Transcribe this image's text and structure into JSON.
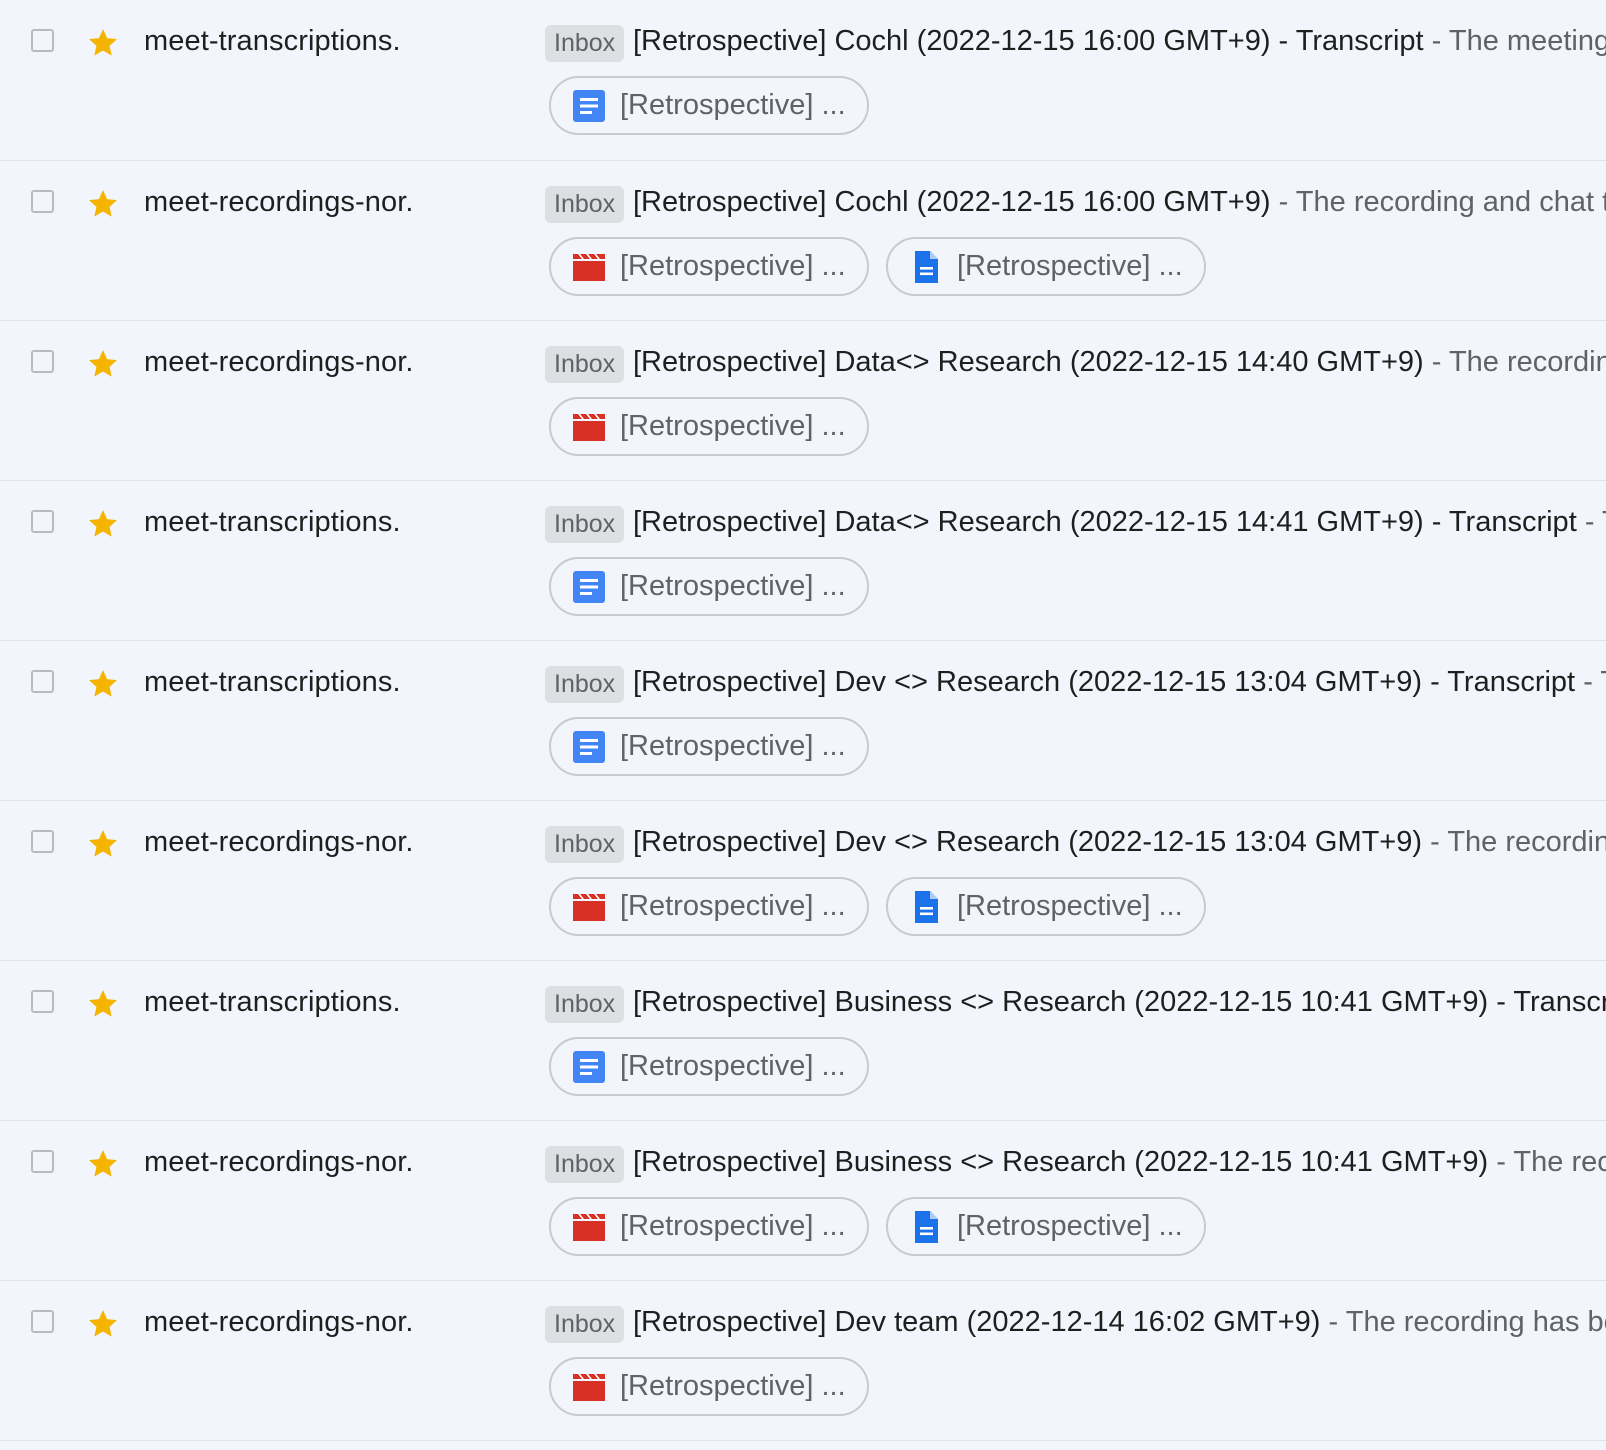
{
  "colors": {
    "star": "#f4b400",
    "doc_icon": "#4285f4",
    "file_icon": "#1a73e8",
    "video_icon": "#d93025"
  },
  "emails": [
    {
      "sender": "meet-transcriptions.",
      "label": "Inbox",
      "subject": "[Retrospective] Cochl (2022-12-15 16:00 GMT+9) - Transcript",
      "separator": "-",
      "snippet": "The meeting t",
      "attachments": [
        {
          "icon": "docs-icon",
          "label": "[Retrospective] ..."
        }
      ]
    },
    {
      "sender": "meet-recordings-nor.",
      "label": "Inbox",
      "subject": "[Retrospective] Cochl (2022-12-15 16:00 GMT+9)",
      "separator": "-",
      "snippet": "The recording and chat tra",
      "attachments": [
        {
          "icon": "video-icon",
          "label": "[Retrospective] ..."
        },
        {
          "icon": "file-icon",
          "label": "[Retrospective] ..."
        }
      ]
    },
    {
      "sender": "meet-recordings-nor.",
      "label": "Inbox",
      "subject": "[Retrospective] Data<> Research (2022-12-15 14:40 GMT+9)",
      "separator": "-",
      "snippet": "The recording h",
      "attachments": [
        {
          "icon": "video-icon",
          "label": "[Retrospective] ..."
        }
      ]
    },
    {
      "sender": "meet-transcriptions.",
      "label": "Inbox",
      "subject": "[Retrospective] Data<> Research (2022-12-15 14:41 GMT+9) - Transcript",
      "separator": "-",
      "snippet": "The",
      "attachments": [
        {
          "icon": "docs-icon",
          "label": "[Retrospective] ..."
        }
      ]
    },
    {
      "sender": "meet-transcriptions.",
      "label": "Inbox",
      "subject": "[Retrospective] Dev <> Research (2022-12-15 13:04 GMT+9) - Transcript",
      "separator": "-",
      "snippet": "The",
      "attachments": [
        {
          "icon": "docs-icon",
          "label": "[Retrospective] ..."
        }
      ]
    },
    {
      "sender": "meet-recordings-nor.",
      "label": "Inbox",
      "subject": "[Retrospective] Dev <> Research (2022-12-15 13:04 GMT+9)",
      "separator": "-",
      "snippet": "The recording a",
      "attachments": [
        {
          "icon": "video-icon",
          "label": "[Retrospective] ..."
        },
        {
          "icon": "file-icon",
          "label": "[Retrospective] ..."
        }
      ]
    },
    {
      "sender": "meet-transcriptions.",
      "label": "Inbox",
      "subject": "[Retrospective] Business <> Research (2022-12-15 10:41 GMT+9) - Transcript",
      "separator": "",
      "snippet": "",
      "attachments": [
        {
          "icon": "docs-icon",
          "label": "[Retrospective] ..."
        }
      ]
    },
    {
      "sender": "meet-recordings-nor.",
      "label": "Inbox",
      "subject": "[Retrospective] Business <> Research (2022-12-15 10:41 GMT+9)",
      "separator": "-",
      "snippet": "The record",
      "attachments": [
        {
          "icon": "video-icon",
          "label": "[Retrospective] ..."
        },
        {
          "icon": "file-icon",
          "label": "[Retrospective] ..."
        }
      ]
    },
    {
      "sender": "meet-recordings-nor.",
      "label": "Inbox",
      "subject": "[Retrospective] Dev team (2022-12-14 16:02 GMT+9)",
      "separator": "-",
      "snippet": "The recording has bee",
      "attachments": [
        {
          "icon": "video-icon",
          "label": "[Retrospective] ..."
        }
      ]
    }
  ]
}
